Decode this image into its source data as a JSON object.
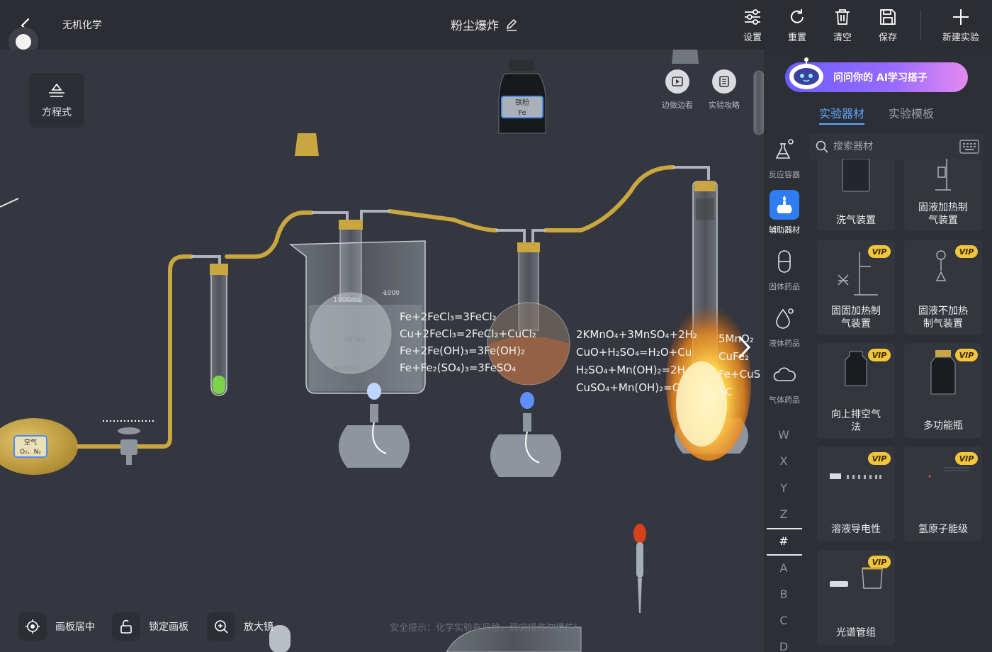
{
  "header": {
    "breadcrumb": "无机化学",
    "title": "粉尘爆炸",
    "toolbar": [
      {
        "label": "设置",
        "icon": "sliders-icon"
      },
      {
        "label": "重置",
        "icon": "refresh-icon"
      },
      {
        "label": "清空",
        "icon": "trash-icon"
      },
      {
        "label": "保存",
        "icon": "save-icon"
      },
      {
        "label": "新建实验",
        "icon": "plus-icon"
      }
    ]
  },
  "canvas": {
    "equation_button": "方程式",
    "mini_tools": [
      {
        "label": "边做边看",
        "icon": "play-icon"
      },
      {
        "label": "实验攻略",
        "icon": "list-icon"
      }
    ],
    "bottle_label": {
      "line1": "铁粉",
      "line2": "Fe"
    },
    "balloon_label": {
      "line1": "空气",
      "line2": "O₂、N₂"
    },
    "equations_left": [
      "Fe+2FeCl₃=3FeCl₂",
      "Cu+2FeCl₃=2FeCl₂+CuCl₂",
      "Fe+2Fe(OH)₃=3Fe(OH)₂",
      "Fe+Fe₂(SO₄)₃=3FeSO₄"
    ],
    "equations_right": [
      "2KMnO₄+3MnSO₄+2H₂",
      "CuO+H₂SO₄=H₂O+Cu",
      "H₂SO₄+Mn(OH)₂=2H",
      "CuSO₄+Mn(OH)₂=C"
    ],
    "equations_far_right": [
      "5MnO₂",
      "CuFe₂",
      "Fe+CuS",
      "SC"
    ],
    "beaker_marks": [
      "1000",
      "1000mL",
      "500mL",
      "NO800K"
    ],
    "bottom_tools": [
      {
        "label": "画板居中",
        "icon": "target-icon"
      },
      {
        "label": "锁定画板",
        "icon": "unlock-icon"
      },
      {
        "label": "放大镜",
        "icon": "zoom-in-icon"
      }
    ],
    "safety_tip": "安全提示：化学实验有风险，现实操作勿模仿!"
  },
  "panel": {
    "ai_banner": "问问你的 AI学习搭子",
    "tabs": [
      {
        "label": "实验器材",
        "active": true
      },
      {
        "label": "实验模板",
        "active": false
      }
    ],
    "search_placeholder": "搜索器材",
    "categories": [
      {
        "label": "反应容器",
        "icon": "flask-icon"
      },
      {
        "label": "辅助器材",
        "icon": "alcohol-lamp-icon",
        "active": true
      },
      {
        "label": "固体药品",
        "icon": "capsule-icon"
      },
      {
        "label": "液体药品",
        "icon": "drop-icon"
      },
      {
        "label": "气体药品",
        "icon": "cloud-icon"
      }
    ],
    "alphabet": [
      "W",
      "X",
      "Y",
      "Z",
      "#",
      "A",
      "B",
      "C",
      "D"
    ],
    "items": [
      {
        "name": "洗气装置",
        "vip": false
      },
      {
        "name": "固液加热制气装置",
        "vip": false
      },
      {
        "name": "固固加热制气装置",
        "vip": true
      },
      {
        "name": "固液不加热制气装置",
        "vip": true
      },
      {
        "name": "向上排空气法",
        "vip": true
      },
      {
        "name": "多功能瓶",
        "vip": true
      },
      {
        "name": "溶液导电性",
        "vip": true
      },
      {
        "name": "氢原子能级",
        "vip": true
      },
      {
        "name": "光谱管组",
        "vip": true
      }
    ],
    "vip_label": "VIP",
    "accent": "#2f7df3",
    "tab_accent": "#5ea8ff"
  }
}
